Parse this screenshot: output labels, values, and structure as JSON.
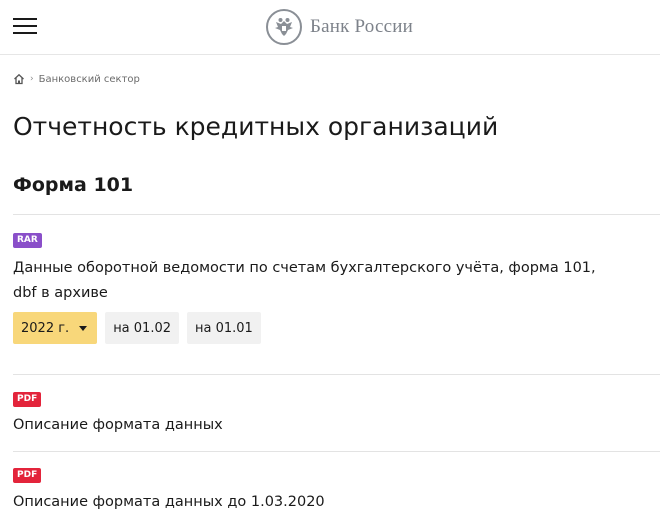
{
  "header": {
    "logo_text": "Банк России"
  },
  "breadcrumb": {
    "items": [
      {
        "label": "Банковский сектор"
      }
    ]
  },
  "page_title": "Отчетность кредитных организаций",
  "section": {
    "title": "Форма 101",
    "documents": [
      {
        "badge": "RAR",
        "title_line1": "Данные оборотной ведомости по счетам бухгалтерского учёта, форма 101,",
        "title_line2": "dbf в архиве",
        "year_select": "2022 г.",
        "dates": [
          "на 01.02",
          "на 01.01"
        ]
      },
      {
        "badge": "PDF",
        "title": "Описание формата данных"
      },
      {
        "badge": "PDF",
        "title": "Описание формата данных до 1.03.2020"
      }
    ]
  },
  "colors": {
    "rar_badge": "#8a4fc9",
    "pdf_badge": "#e3243b",
    "year_select_bg": "#f8d77a",
    "date_chip_bg": "#f1f1f1"
  },
  "icons": {
    "menu": "hamburger-icon",
    "logo": "double-headed-eagle-emblem",
    "home": "home-icon",
    "dropdown": "caret-down-icon"
  }
}
